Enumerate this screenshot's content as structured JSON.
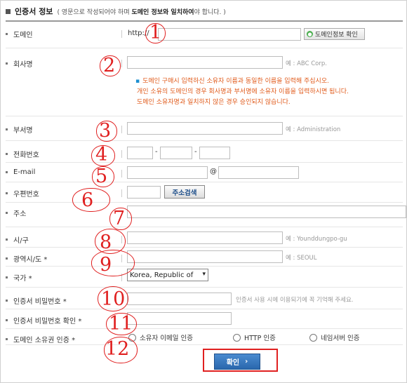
{
  "header": {
    "title": "인증서 정보",
    "subtitle_pre": "( 영문으로 작성되어야 하며 ",
    "subtitle_highlight": "도메인 정보와 일치하여",
    "subtitle_post": "야 합니다. )"
  },
  "fields": {
    "domain": {
      "label": "도메인",
      "prefix": "http://",
      "button": "도메인정보 확인"
    },
    "company": {
      "label": "회사명",
      "hint": "예 : ABC Corp."
    },
    "company_note": [
      "도메인 구매시 입력하신 소유자 이름과 동일한 이름을 입력해 주십시오.",
      "개인 소유의 도메인의 경우 회사명과 부서명에 소유자 이름을 입력하시면 됩니다.",
      "도메인 소유자명과 일치하지 않은 경우 승인되지 않습니다."
    ],
    "department": {
      "label": "부서명",
      "hint": "예 : Administration"
    },
    "phone": {
      "label": "전화번호",
      "dash": "-"
    },
    "email": {
      "label": "E-mail",
      "at": "@"
    },
    "zipcode": {
      "label": "우편번호",
      "button": "주소검색"
    },
    "address": {
      "label": "주소"
    },
    "city": {
      "label": "시/구",
      "hint": "예 : Younddungpo-gu"
    },
    "province": {
      "label": "광역시/도 *",
      "hint": "예 : SEOUL"
    },
    "country": {
      "label": "국가 *",
      "value": "Korea, Republic of"
    },
    "password": {
      "label": "인증서 비밀번호 *",
      "hint": "인증서 사용 시에 이용되기에 꼭 기억해 주세요."
    },
    "password_confirm": {
      "label": "인증서 비밀번호 확인 *"
    },
    "ownership": {
      "label": "도메인 소유권 인증 *",
      "options": [
        "소유자 이메일 인증",
        "HTTP 인증",
        "네임서버 인증"
      ]
    }
  },
  "confirm": {
    "label": "확인"
  },
  "annotations": [
    "1",
    "2",
    "3",
    "4",
    "5",
    "6",
    "7",
    "8",
    "9",
    "10",
    "11",
    "12"
  ],
  "colors": {
    "annotation": "#e02020",
    "note": "#e05a1a",
    "button_blue": "#2a67ad"
  }
}
